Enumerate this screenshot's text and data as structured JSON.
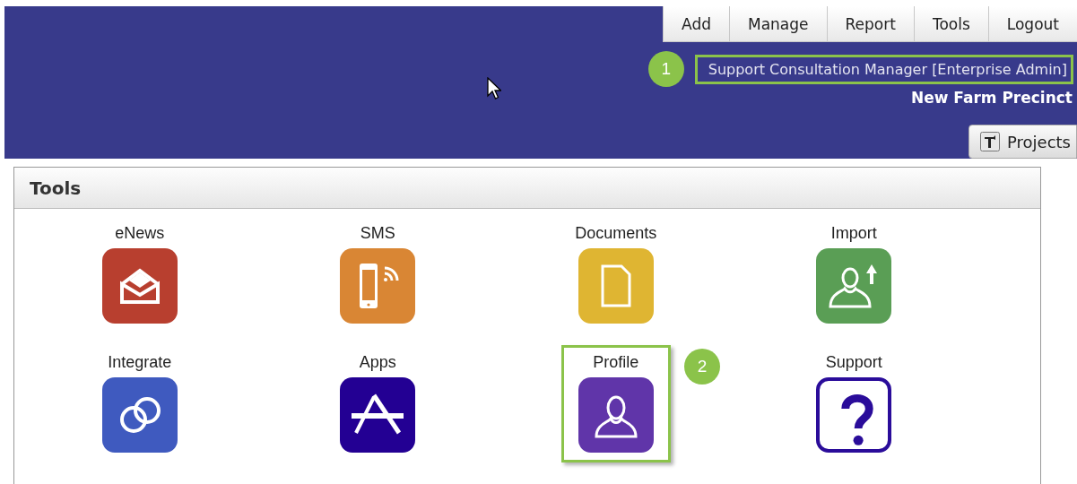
{
  "menu": [
    {
      "label": "Add"
    },
    {
      "label": "Manage"
    },
    {
      "label": "Report"
    },
    {
      "label": "Tools"
    },
    {
      "label": "Logout"
    }
  ],
  "user": {
    "role": "Support Consultation Manager [Enterprise Admin]",
    "highlighted": true,
    "callout": "1"
  },
  "organisation": "New Farm Precinct",
  "projects_button": {
    "label": "Projects"
  },
  "panel": {
    "title": "Tools",
    "tools": [
      {
        "label": "eNews",
        "kind": "envelope",
        "color": "#b83f2f",
        "highlighted": false
      },
      {
        "label": "SMS",
        "kind": "phone",
        "color": "#d98634",
        "highlighted": false
      },
      {
        "label": "Documents",
        "kind": "document",
        "color": "#dfb532",
        "highlighted": false
      },
      {
        "label": "Import",
        "kind": "upload",
        "color": "#5a9e55",
        "highlighted": false
      },
      {
        "label": "Integrate",
        "kind": "rings",
        "color": "#3f5abf",
        "highlighted": false
      },
      {
        "label": "Apps",
        "kind": "appstore",
        "color": "#230093",
        "highlighted": false
      },
      {
        "label": "Profile",
        "kind": "person",
        "color": "#6035a9",
        "highlighted": true,
        "callout": "2"
      },
      {
        "label": "Support",
        "kind": "question",
        "color": "#2a0c9a",
        "highlighted": false
      }
    ]
  }
}
